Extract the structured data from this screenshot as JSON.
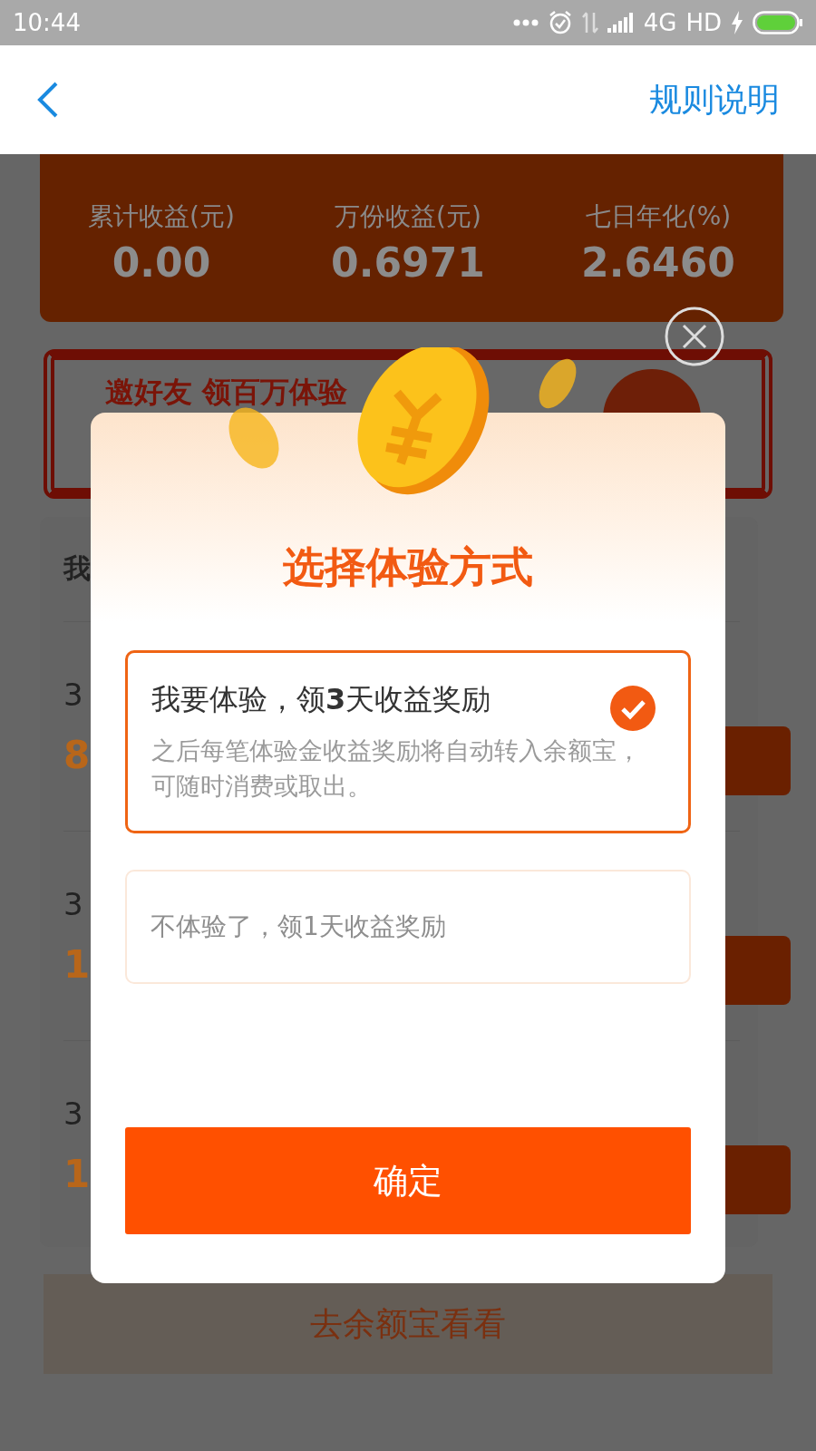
{
  "status_bar": {
    "time": "10:44",
    "network": "4G",
    "hd": "HD"
  },
  "header": {
    "action": "规则说明"
  },
  "stats": [
    {
      "label": "累计收益(元)",
      "value": "0.00"
    },
    {
      "label": "万份收益(元)",
      "value": "0.6971"
    },
    {
      "label": "七日年化(%)",
      "value": "2.6460"
    }
  ],
  "invite_banner": {
    "text": "邀好友 领百万体验"
  },
  "records": {
    "heading": "我",
    "rows": [
      {
        "line_1": "3",
        "line_2": "8"
      },
      {
        "line_1": "3",
        "line_2": "1"
      },
      {
        "line_1": "3",
        "line_2": "1"
      }
    ]
  },
  "bottom_link": "去余额宝看看",
  "dialog": {
    "title": "选择体验方式",
    "options": [
      {
        "title": "我要体验，领**3**天收益奖励",
        "description": "之后每笔体验金收益奖励将自动转入余额宝，可随时消费或取出。",
        "selected": true
      },
      {
        "title": "不体验了，领1天收益奖励",
        "selected": false
      }
    ],
    "confirm": "确定"
  }
}
